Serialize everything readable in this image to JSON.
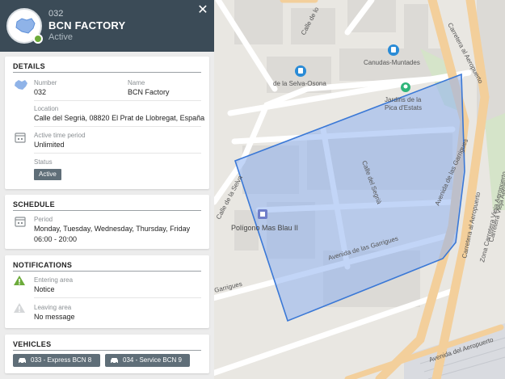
{
  "header": {
    "number": "032",
    "title": "BCN FACTORY",
    "status": "Active",
    "close_label": "✕"
  },
  "details": {
    "title": "DETAILS",
    "number_label": "Number",
    "number_value": "032",
    "name_label": "Name",
    "name_value": "BCN Factory",
    "location_label": "Location",
    "location_value": "Calle del Segrià, 08820 El Prat de Llobregat, España",
    "period_label": "Active time period",
    "period_value": "Unlimited",
    "status_label": "Status",
    "status_value": "Active"
  },
  "schedule": {
    "title": "SCHEDULE",
    "period_label": "Period",
    "days": "Monday, Tuesday, Wednesday, Thursday, Friday",
    "hours": "06:00 - 20:00"
  },
  "notifications": {
    "title": "NOTIFICATIONS",
    "entering_label": "Entering area",
    "entering_value": "Notice",
    "leaving_label": "Leaving area",
    "leaving_value": "No message"
  },
  "vehicles": {
    "title": "VEHICLES",
    "items": [
      {
        "label": "033 - Express BCN 8"
      },
      {
        "label": "034 - Service BCN 9"
      }
    ]
  },
  "map": {
    "labels": {
      "calle_lo": "Calle de lo",
      "carretera_1": "Carretera al Aeropuerto",
      "carretera_2": "Carretera al Aeropuerto",
      "carretera_vieja": "Carretera Vieja Aeropuerto",
      "zona": "Zona Carretera Vieja Aeropuerto",
      "canudas": "Canudas-Muntades",
      "selva_osona": "de la Selva-Osona",
      "jardins": "Jardins de la",
      "pica": "Pica d'Estats",
      "calle_selva": "Calle de la Selva",
      "calle_segria": "Calle del Segrià",
      "avenida_garrigues_1": "Avenida de las Garrigues",
      "avenida_garrigues_2": "Avenida de las Garrigues",
      "avenida_garrigues_3": "Avenida de las Garrigues",
      "garrigues_left": "Garrigues",
      "poligono": "Polígono Mas Blau II",
      "avenida_aeropuerto": "Avenida del Aeropuerto"
    },
    "colors": {
      "geofence_fill": "#8fb3f0",
      "geofence_stroke": "#3a78d6",
      "road_major": "#f3cf9b",
      "transit": "#2a8bd6"
    }
  }
}
